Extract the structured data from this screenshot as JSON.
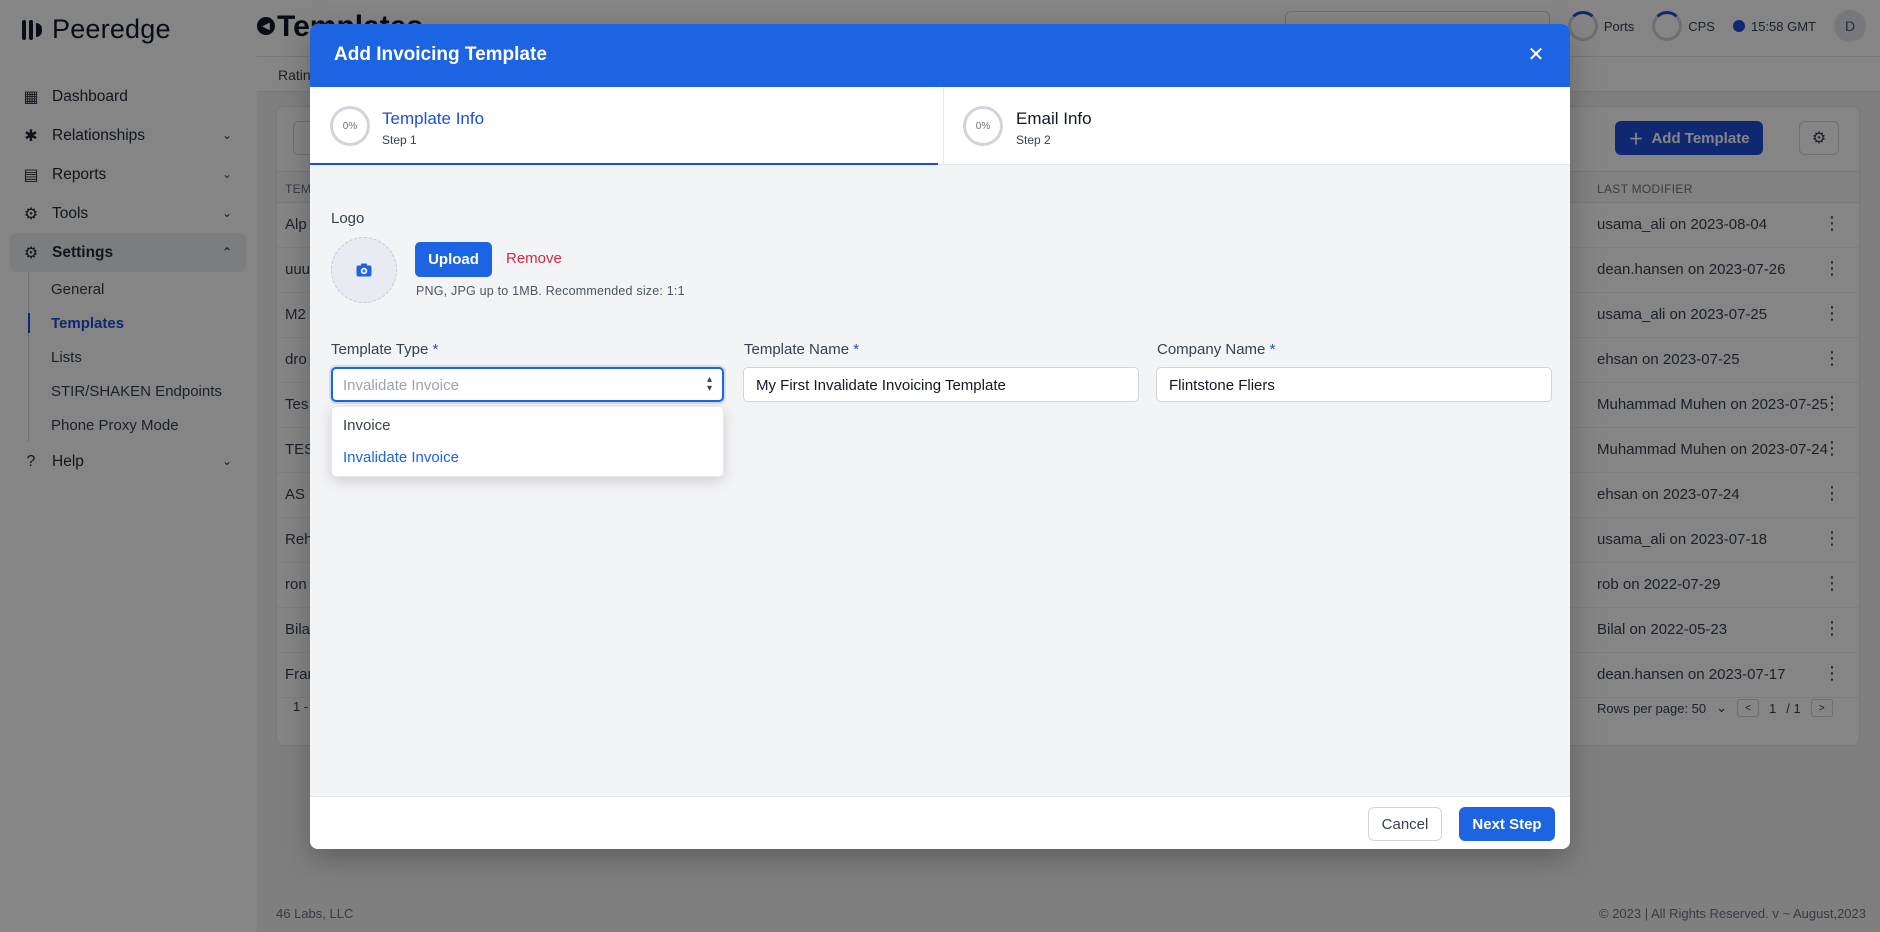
{
  "app": {
    "name": "Peeredge"
  },
  "sidebar": {
    "items": [
      {
        "label": "Dashboard",
        "icon": "dashboard-icon"
      },
      {
        "label": "Relationships",
        "icon": "relationships-icon"
      },
      {
        "label": "Reports",
        "icon": "reports-icon"
      },
      {
        "label": "Tools",
        "icon": "tools-icon"
      },
      {
        "label": "Settings",
        "icon": "gear-icon"
      },
      {
        "label": "Help",
        "icon": "help-icon"
      }
    ],
    "settings_sub": [
      "General",
      "Templates",
      "Lists",
      "STIR/SHAKEN Endpoints",
      "Phone Proxy Mode"
    ]
  },
  "header": {
    "page_title": "Templates",
    "ports_label": "Ports",
    "cps_label": "CPS",
    "time": "15:58 GMT",
    "avatar_initial": "D",
    "tab0": "Ratin"
  },
  "table": {
    "add_button": "Add Template",
    "col_template": "TEM",
    "col_last_modifier": "LAST MODIFIER",
    "rows": [
      {
        "name": "Alp",
        "modifier": "usama_ali on 2023-08-04"
      },
      {
        "name": "uuu",
        "modifier": "dean.hansen on 2023-07-26"
      },
      {
        "name": "M2",
        "modifier": "usama_ali on 2023-07-25"
      },
      {
        "name": "dro",
        "modifier": "ehsan on 2023-07-25"
      },
      {
        "name": "Tes",
        "modifier": "Muhammad Muhen on 2023-07-25"
      },
      {
        "name": "TES",
        "modifier": "Muhammad Muhen on 2023-07-24"
      },
      {
        "name": "AS",
        "modifier": "ehsan on 2023-07-24"
      },
      {
        "name": "Reh",
        "modifier": "usama_ali on 2023-07-18"
      },
      {
        "name": "ron",
        "modifier": "rob on 2022-07-29"
      },
      {
        "name": "Bila",
        "modifier": "Bilal on 2022-05-23"
      },
      {
        "name": "Fran",
        "modifier": "dean.hansen on 2023-07-17"
      }
    ],
    "pager_left": "1 -",
    "rows_per_page": "Rows per page: 50",
    "page_current": "1",
    "page_total": "/ 1"
  },
  "footer": {
    "left": "46 Labs, LLC",
    "right": "© 2023 | All Rights Reserved. v ~ August,2023"
  },
  "modal": {
    "title": "Add Invoicing Template",
    "steps": [
      {
        "progress": "0%",
        "title": "Template Info",
        "sub": "Step 1"
      },
      {
        "progress": "0%",
        "title": "Email Info",
        "sub": "Step 2"
      }
    ],
    "logo_label": "Logo",
    "upload_label": "Upload",
    "remove_label": "Remove",
    "logo_hint": "PNG, JPG up to 1MB. Recommended size: 1:1",
    "template_type_label": "Template Type",
    "template_type_value": "Invalidate Invoice",
    "template_type_options": [
      "Invoice",
      "Invalidate Invoice"
    ],
    "template_name_label": "Template Name",
    "template_name_value": "My First Invalidate Invoicing Template",
    "company_name_label": "Company Name",
    "company_name_value": "Flintstone Fliers",
    "required_mark": "*",
    "cancel_label": "Cancel",
    "next_label": "Next Step"
  },
  "colors": {
    "primary": "#1d64e3",
    "danger": "#dc2640",
    "overlay": "rgba(0,0,0,0.48)"
  }
}
